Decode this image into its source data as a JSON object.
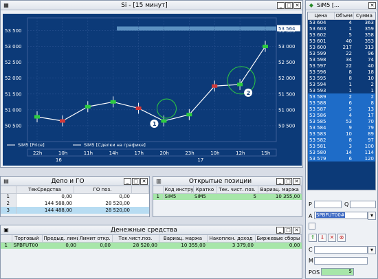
{
  "chart_window": {
    "title": "Si - [15 минут]",
    "price_axis": [
      "53 500",
      "53 000",
      "52 500",
      "52 000",
      "51 500",
      "51 000",
      "50 500"
    ],
    "current_price": "53 564",
    "time_labels": [
      "22h",
      "10h",
      "11h",
      "14h",
      "17h",
      "20h",
      "23h",
      "10h",
      "12h",
      "15h"
    ],
    "day_labels": [
      "16",
      "17"
    ],
    "legend": [
      "SiM5 [Price]",
      "SiM5 [Сделки на графике]"
    ],
    "markers": [
      "1",
      "2"
    ]
  },
  "chart_data": {
    "type": "line",
    "x": [
      "22h",
      "10h",
      "11h",
      "14h",
      "17h",
      "20h",
      "23h",
      "10h",
      "12h",
      "15h"
    ],
    "series": [
      {
        "name": "SiM5 [Price]",
        "values": [
          50780,
          50650,
          51100,
          51250,
          51050,
          50650,
          50850,
          51750,
          51800,
          53000
        ]
      }
    ],
    "ylim": [
      50000,
      53900
    ]
  },
  "orderbook": {
    "title": "SiM5 [...",
    "headers": [
      "Цена",
      "Объем",
      "Сумма"
    ],
    "asks": [
      [
        "53 604",
        "4",
        "363"
      ],
      [
        "53 603",
        "1",
        "359"
      ],
      [
        "53 602",
        "5",
        "358"
      ],
      [
        "53 601",
        "40",
        "353"
      ],
      [
        "53 600",
        "217",
        "313"
      ],
      [
        "53 599",
        "22",
        "96"
      ],
      [
        "53 598",
        "34",
        "74"
      ],
      [
        "53 597",
        "22",
        "40"
      ],
      [
        "53 596",
        "8",
        "18"
      ],
      [
        "53 595",
        "8",
        "10"
      ],
      [
        "53 594",
        "1",
        "2"
      ],
      [
        "53 593",
        "1",
        "1"
      ]
    ],
    "bids": [
      [
        "53 589",
        "2",
        "2"
      ],
      [
        "53 588",
        "6",
        "8"
      ],
      [
        "53 587",
        "5",
        "13"
      ],
      [
        "53 586",
        "4",
        "17"
      ],
      [
        "53 585",
        "53",
        "70"
      ],
      [
        "53 584",
        "9",
        "79"
      ],
      [
        "53 583",
        "10",
        "89"
      ],
      [
        "53 582",
        "8",
        "97"
      ],
      [
        "53 581",
        "3",
        "100"
      ],
      [
        "53 580",
        "14",
        "114"
      ],
      [
        "53 579",
        "6",
        "120"
      ]
    ],
    "field_p": "P",
    "field_q": "Q",
    "field_a": "A",
    "account": "SPBFUT00#",
    "field_c": "C",
    "field_m": "M",
    "pos_label": "POS",
    "pos_value": "5"
  },
  "depo": {
    "title": "Депо и ГО",
    "headers": [
      "",
      "ТекСредства",
      "ГО поз."
    ],
    "rows": [
      [
        "1",
        "0,00",
        "0,00"
      ],
      [
        "2",
        "144 588,00",
        "28 520,00"
      ],
      [
        "3",
        "144 488,00",
        "28 520,00"
      ]
    ]
  },
  "positions": {
    "title": "Открытые позиции",
    "headers": [
      "",
      "Код инстру",
      "Кратко",
      "Тек. чист. поз.",
      "Вариац. маржа"
    ],
    "rows": [
      [
        "1",
        "SiM5",
        "SiM5",
        "5",
        "10 355,00"
      ]
    ]
  },
  "money": {
    "title": "Денежные средства",
    "headers": [
      "",
      "Торговый",
      "Предыд. лими",
      "Лимит откр.",
      "Тек.чист.поз.",
      "Вариац. маржа",
      "Накоплен. доход",
      "Биржевые сборы"
    ],
    "rows": [
      [
        "1",
        "SPBFUT00",
        "0,00",
        "0,00",
        "28 520,00",
        "10 355,00",
        "3 379,00",
        "0,00"
      ]
    ]
  }
}
